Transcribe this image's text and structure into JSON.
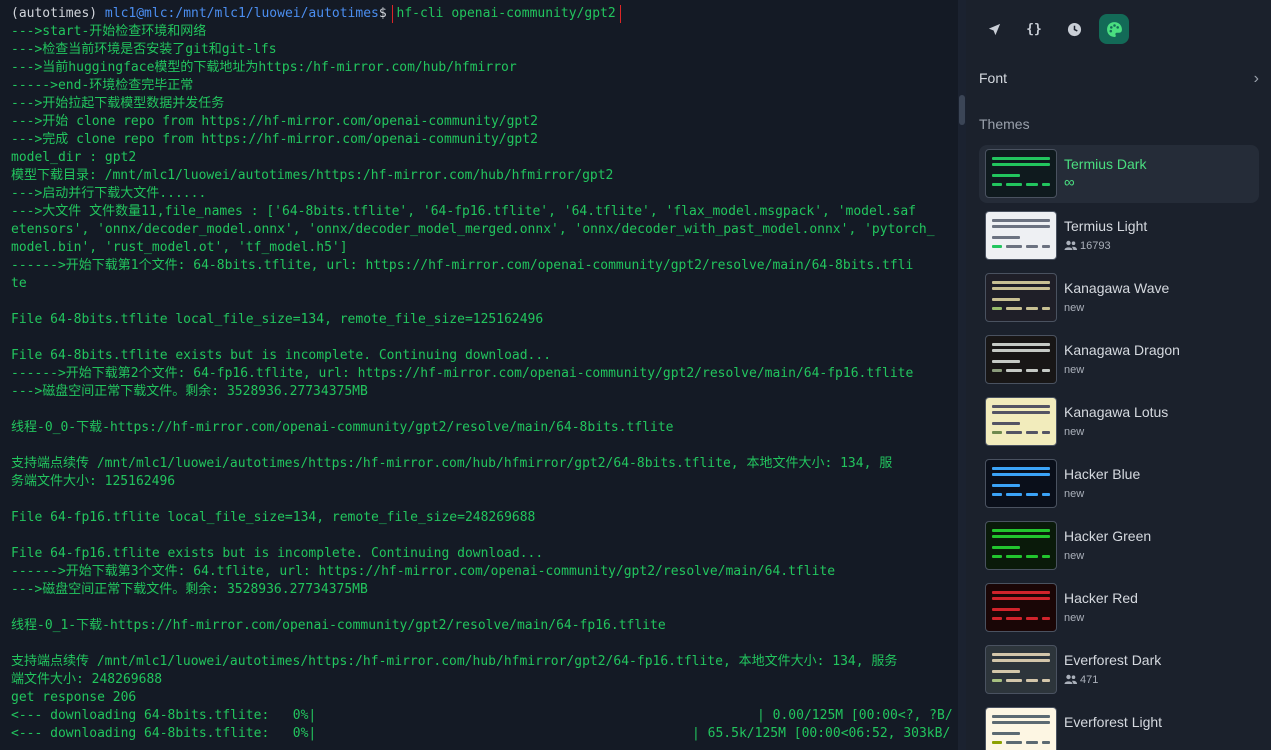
{
  "terminal": {
    "prompt": {
      "env": "(autotimes) ",
      "user": "mlc1@mlc",
      "path": ":/mnt/mlc1/luowei/autotimes",
      "sign": "$ ",
      "command": "hf-cli openai-community/gpt2"
    },
    "lines": [
      "--->start-开始检查环境和网络",
      "--->检查当前环境是否安装了git和git-lfs",
      "--->当前huggingface模型的下载地址为https:/hf-mirror.com/hub/hfmirror",
      "----->end-环境检查完毕正常",
      "--->开始拉起下载模型数据并发任务",
      "--->开始 clone repo from https://hf-mirror.com/openai-community/gpt2",
      "--->完成 clone repo from https://hf-mirror.com/openai-community/gpt2",
      "model_dir : gpt2",
      "模型下载目录: /mnt/mlc1/luowei/autotimes/https:/hf-mirror.com/hub/hfmirror/gpt2",
      "--->启动并行下载大文件......",
      "--->大文件 文件数量11,file_names : ['64-8bits.tflite', '64-fp16.tflite', '64.tflite', 'flax_model.msgpack', 'model.saf",
      "etensors', 'onnx/decoder_model.onnx', 'onnx/decoder_model_merged.onnx', 'onnx/decoder_with_past_model.onnx', 'pytorch_",
      "model.bin', 'rust_model.ot', 'tf_model.h5']",
      "------>开始下载第1个文件: 64-8bits.tflite, url: https://hf-mirror.com/openai-community/gpt2/resolve/main/64-8bits.tfli",
      "te",
      "",
      "File 64-8bits.tflite local_file_size=134, remote_file_size=125162496",
      "",
      "File 64-8bits.tflite exists but is incomplete. Continuing download...",
      "------>开始下载第2个文件: 64-fp16.tflite, url: https://hf-mirror.com/openai-community/gpt2/resolve/main/64-fp16.tflite",
      "--->磁盘空间正常下载文件。剩余: 3528936.27734375MB",
      "",
      "线程-0_0-下载-https://hf-mirror.com/openai-community/gpt2/resolve/main/64-8bits.tflite",
      "",
      "支持端点续传 /mnt/mlc1/luowei/autotimes/https:/hf-mirror.com/hub/hfmirror/gpt2/64-8bits.tflite, 本地文件大小: 134, 服",
      "务端文件大小: 125162496",
      "",
      "File 64-fp16.tflite local_file_size=134, remote_file_size=248269688",
      "",
      "File 64-fp16.tflite exists but is incomplete. Continuing download...",
      "------>开始下载第3个文件: 64.tflite, url: https://hf-mirror.com/openai-community/gpt2/resolve/main/64.tflite",
      "--->磁盘空间正常下载文件。剩余: 3528936.27734375MB",
      "",
      "线程-0_1-下载-https://hf-mirror.com/openai-community/gpt2/resolve/main/64-fp16.tflite",
      "",
      "支持端点续传 /mnt/mlc1/luowei/autotimes/https:/hf-mirror.com/hub/hfmirror/gpt2/64-fp16.tflite, 本地文件大小: 134, 服务",
      "端文件大小: 248269688",
      "get response 206"
    ],
    "progress": [
      {
        "left": "<--- downloading 64-8bits.tflite:   0%|",
        "right": "| 0.00/125M [00:00<?, ?B/"
      },
      {
        "left": "<--- downloading 64-8bits.tflite:   0%|",
        "right": "| 65.5k/125M [00:00<06:52, 303kB/"
      }
    ]
  },
  "toolbar": {
    "icons": [
      "rocket-icon",
      "braces-icon",
      "history-icon",
      "palette-icon"
    ],
    "active_color": "#4ade80"
  },
  "panel": {
    "font_label": "Font",
    "themes_label": "Themes",
    "themes": [
      {
        "name": "Termius Dark",
        "sub": "∞",
        "sub_type": "inf",
        "bg": "#0f1a1e",
        "bar": "#22c55e",
        "accent": "#22c55e",
        "selected": true
      },
      {
        "name": "Termius Light",
        "sub": "16793",
        "sub_type": "users",
        "bg": "#eef0f3",
        "bar": "#6b7280",
        "accent": "#22c55e",
        "selected": false
      },
      {
        "name": "Kanagawa Wave",
        "sub": "new",
        "sub_type": "text",
        "bg": "#1f1f28",
        "bar": "#c8c093",
        "accent": "#98bb6c",
        "selected": false
      },
      {
        "name": "Kanagawa Dragon",
        "sub": "new",
        "sub_type": "text",
        "bg": "#181616",
        "bar": "#c5c9c5",
        "accent": "#8a9a7b",
        "selected": false
      },
      {
        "name": "Kanagawa Lotus",
        "sub": "new",
        "sub_type": "text",
        "bg": "#f2ecbc",
        "bar": "#545464",
        "accent": "#6f894e",
        "selected": false
      },
      {
        "name": "Hacker Blue",
        "sub": "new",
        "sub_type": "text",
        "bg": "#0a0f1a",
        "bar": "#3ba3f7",
        "accent": "#3ba3f7",
        "selected": false
      },
      {
        "name": "Hacker Green",
        "sub": "new",
        "sub_type": "text",
        "bg": "#0a1a0a",
        "bar": "#22c52e",
        "accent": "#22c52e",
        "selected": false
      },
      {
        "name": "Hacker Red",
        "sub": "new",
        "sub_type": "text",
        "bg": "#1a0606",
        "bar": "#d0232b",
        "accent": "#d0232b",
        "selected": false
      },
      {
        "name": "Everforest Dark",
        "sub": "471",
        "sub_type": "users",
        "bg": "#2d353b",
        "bar": "#d3c6aa",
        "accent": "#a7c080",
        "selected": false
      },
      {
        "name": "Everforest Light",
        "sub": "",
        "sub_type": "text",
        "bg": "#fdf6e3",
        "bar": "#5c6a72",
        "accent": "#8da101",
        "selected": false
      }
    ]
  }
}
